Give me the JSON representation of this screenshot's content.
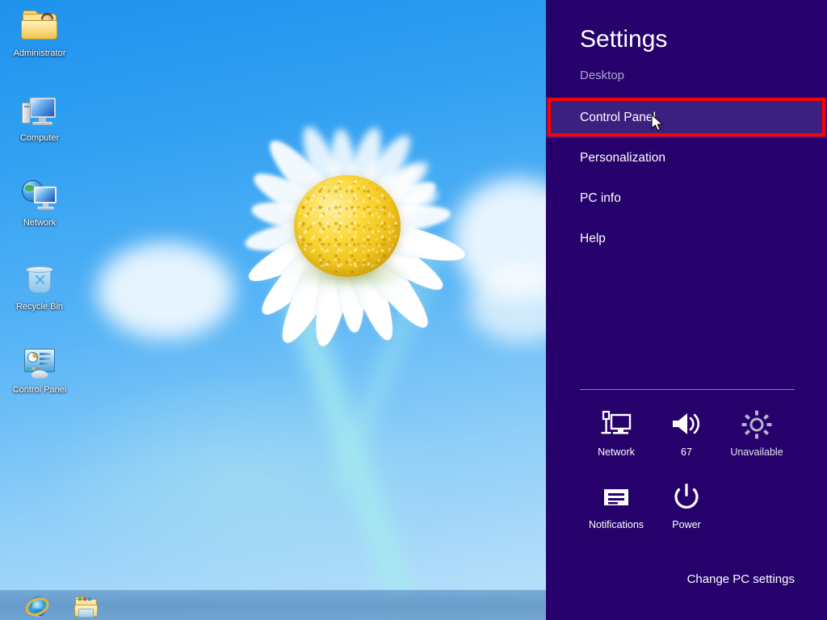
{
  "desktop": {
    "icons": [
      {
        "label": "Administrator",
        "icon": "user-folder-icon"
      },
      {
        "label": "Computer",
        "icon": "computer-monitor-icon"
      },
      {
        "label": "Network",
        "icon": "network-globe-icon"
      },
      {
        "label": "Recycle Bin",
        "icon": "recycle-bin-icon"
      },
      {
        "label": "Control Panel",
        "icon": "control-panel-icon"
      }
    ],
    "wallpaper": "white-daisy-on-blue-sky"
  },
  "taskbar": {
    "items": [
      {
        "label": "Internet Explorer",
        "icon": "internet-explorer-icon"
      },
      {
        "label": "File Explorer",
        "icon": "file-explorer-icon"
      }
    ]
  },
  "charm": {
    "title": "Settings",
    "subtitle": "Desktop",
    "background_color": "#26006b",
    "highlight_color": "#3c2080",
    "callout_color": "#fe0000",
    "items": [
      {
        "label": "Control Panel",
        "highlighted": true
      },
      {
        "label": "Personalization",
        "highlighted": false
      },
      {
        "label": "PC info",
        "highlighted": false
      },
      {
        "label": "Help",
        "highlighted": false
      }
    ],
    "quick_actions": [
      {
        "label": "Network",
        "icon": "network-monitor-icon",
        "state": "available"
      },
      {
        "label": "67",
        "icon": "volume-speaker-icon",
        "state": "available"
      },
      {
        "label": "Unavailable",
        "icon": "brightness-sun-icon",
        "state": "unavailable"
      },
      {
        "label": "Notifications",
        "icon": "notifications-icon",
        "state": "available"
      },
      {
        "label": "Power",
        "icon": "power-icon",
        "state": "available"
      }
    ],
    "footer_link": "Change PC settings"
  }
}
